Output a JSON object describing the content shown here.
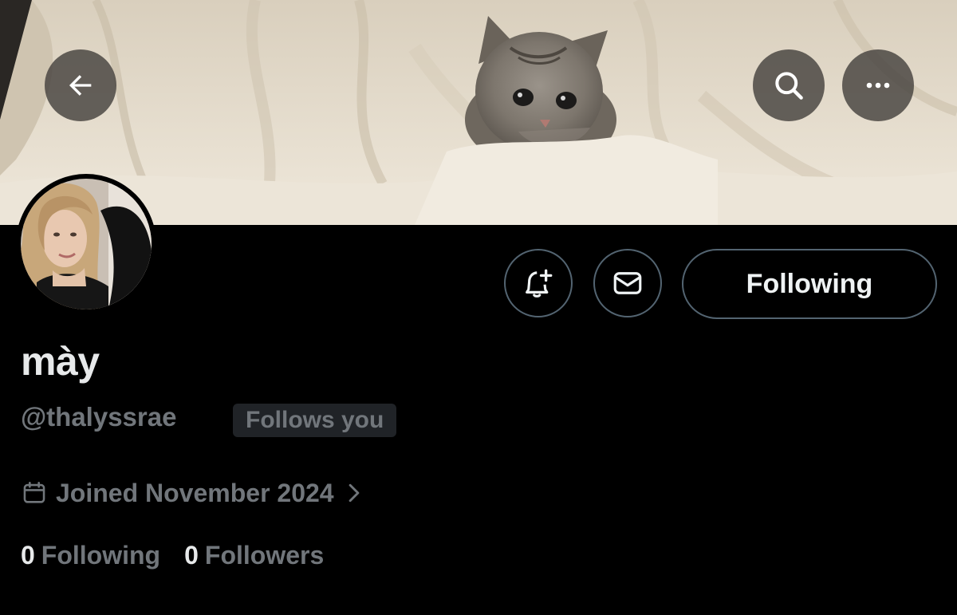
{
  "header": {
    "banner_image": "kitten-in-white-blanket",
    "back_icon": "arrow-left-icon",
    "search_icon": "search-icon",
    "more_icon": "more-horizontal-icon"
  },
  "profile": {
    "avatar_image": "profile-photo",
    "display_name": "mày",
    "handle": "@thalyssrae",
    "follows_you_badge": "Follows you",
    "joined_text": "Joined November 2024"
  },
  "actions": {
    "notify_icon": "bell-plus-icon",
    "message_icon": "envelope-icon",
    "following_label": "Following"
  },
  "stats": {
    "following_count": "0",
    "following_label": "Following",
    "followers_count": "0",
    "followers_label": "Followers"
  },
  "colors": {
    "background": "#000000",
    "text_primary": "#e7e9ea",
    "text_secondary": "#71767b",
    "border": "#536471",
    "badge_bg": "#202327"
  }
}
